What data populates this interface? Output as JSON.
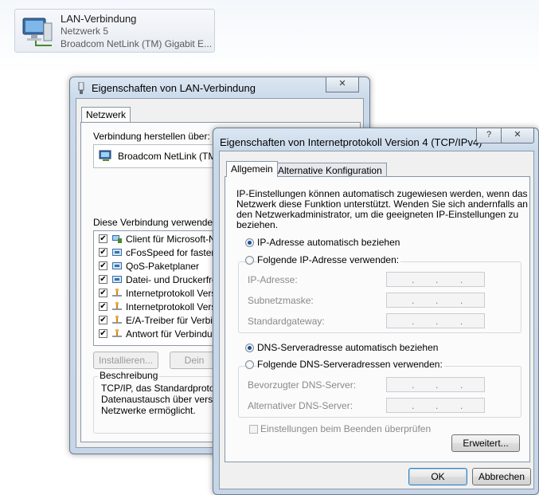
{
  "lan": {
    "title": "LAN-Verbindung",
    "network": "Netzwerk  5",
    "adapter": "Broadcom NetLink (TM) Gigabit E..."
  },
  "props": {
    "title": "Eigenschaften von LAN-Verbindung",
    "close_label": "✕",
    "tab_label": "Netzwerk",
    "connect_via_label": "Verbindung herstellen über:",
    "adapter_name": "Broadcom NetLink (TM) G",
    "uses_label": "Diese Verbindung verwendet fol",
    "items": [
      {
        "label": "Client für Microsoft-Netz",
        "checked": true,
        "icon": "client-icon"
      },
      {
        "label": "cFosSpeed for faster In",
        "checked": true,
        "icon": "network-service-icon"
      },
      {
        "label": "QoS-Paketplaner",
        "checked": true,
        "icon": "network-service-icon"
      },
      {
        "label": "Datei- und Druckerfreig",
        "checked": true,
        "icon": "network-service-icon"
      },
      {
        "label": "Internetprotokoll Versio",
        "checked": true,
        "icon": "protocol-icon"
      },
      {
        "label": "Internetprotokoll Versio",
        "checked": true,
        "icon": "protocol-icon"
      },
      {
        "label": "E/A-Treiber für Verbind",
        "checked": true,
        "icon": "protocol-icon"
      },
      {
        "label": "Antwort für Verbindung",
        "checked": true,
        "icon": "protocol-icon"
      }
    ],
    "install_label": "Installieren...",
    "uninstall_label": "Dein",
    "description_legend": "Beschreibung",
    "description_lines": [
      "TCP/IP, das Standardprotoko",
      "Datenaustausch über verschi",
      "Netzwerke ermöglicht."
    ]
  },
  "ipv4": {
    "title": "Eigenschaften von Internetprotokoll Version 4 (TCP/IPv4)",
    "help_label": "?",
    "close_label": "✕",
    "tabs": [
      "Allgemein",
      "Alternative Konfiguration"
    ],
    "intro": [
      "IP-Einstellungen können automatisch zugewiesen werden, wenn das",
      "Netzwerk diese Funktion unterstützt. Wenden Sie sich andernfalls an",
      "den Netzwerkadministrator, um die geeigneten IP-Einstellungen zu",
      "beziehen."
    ],
    "ip_auto": "IP-Adresse automatisch beziehen",
    "ip_manual": "Folgende IP-Adresse verwenden:",
    "ip_address": "IP-Adresse:",
    "subnet": "Subnetzmaske:",
    "gateway": "Standardgateway:",
    "dns_auto": "DNS-Serveradresse automatisch beziehen",
    "dns_manual": "Folgende DNS-Serveradressen verwenden:",
    "dns_preferred": "Bevorzugter DNS-Server:",
    "dns_alternate": "Alternativer DNS-Server:",
    "validate": "Einstellungen beim Beenden überprüfen",
    "advanced": "Erweitert...",
    "ok": "OK",
    "cancel": "Abbrechen",
    "ip_auto_selected": true,
    "dns_auto_selected": true
  },
  "colors": {
    "accent": "#1b4f9e",
    "disabled_text": "#8a8a8a"
  }
}
